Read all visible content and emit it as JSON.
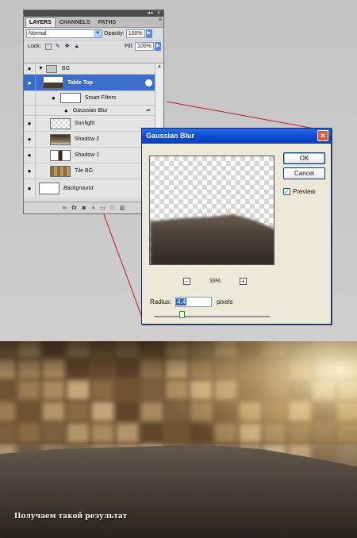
{
  "layers_panel": {
    "tabs": [
      "LAYERS",
      "CHANNELS",
      "PATHS"
    ],
    "window_controls": {
      "collapse": "◂◂",
      "close": "x"
    },
    "menu_icon": "≡",
    "blend_mode": "Normal",
    "opacity_label": "Opacity:",
    "opacity_value": "100%",
    "lock_label": "Lock:",
    "fill_label": "Fill:",
    "fill_value": "100%",
    "layers": [
      {
        "name": "BG",
        "type": "group"
      },
      {
        "name": "Table Top",
        "type": "smart-object",
        "selected": true
      },
      {
        "name": "Smart Filters",
        "type": "smart-filters"
      },
      {
        "name": "Gaussian Blur",
        "type": "filter"
      },
      {
        "name": "Sunlight",
        "type": "layer"
      },
      {
        "name": "Shadow 2",
        "type": "layer"
      },
      {
        "name": "Shadow 1",
        "type": "layer"
      },
      {
        "name": "Tile BG",
        "type": "layer"
      },
      {
        "name": "Background",
        "type": "background"
      }
    ],
    "footer_icons": [
      "link-icon",
      "fx-icon",
      "mask-icon",
      "adjustment-icon",
      "folder-icon",
      "new-layer-icon",
      "trash-icon"
    ]
  },
  "dialog": {
    "title": "Gaussian Blur",
    "ok_label": "OK",
    "cancel_label": "Cancel",
    "preview_label": "Preview",
    "preview_checked": true,
    "zoom": "33%",
    "zoom_minus": "−",
    "zoom_plus": "+",
    "radius_label": "Radius:",
    "radius_value": "4.4",
    "radius_unit": "pixels",
    "slider_level": 0.22
  },
  "caption": "Получаем такой результат",
  "colors": {
    "selection": "#3a6ec9",
    "xp_title": "#0b4fd3",
    "connector": "#b51d1d"
  }
}
